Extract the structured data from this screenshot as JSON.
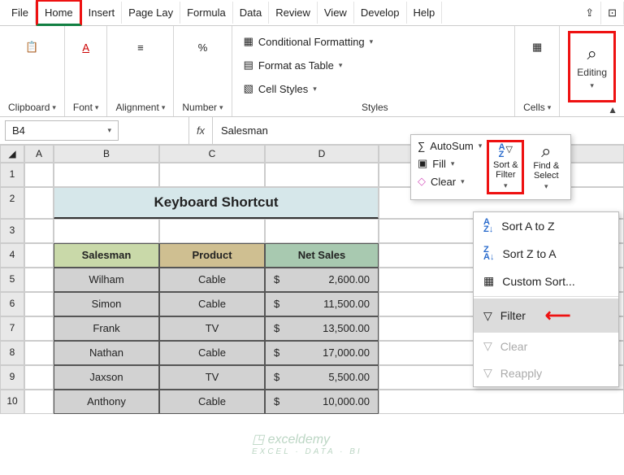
{
  "menu": {
    "tabs": [
      "File",
      "Home",
      "Insert",
      "Page Lay",
      "Formula",
      "Data",
      "Review",
      "View",
      "Develop",
      "Help"
    ],
    "active": 1
  },
  "ribbon": {
    "groups": [
      "Clipboard",
      "Font",
      "Alignment",
      "Number"
    ],
    "styles": {
      "caption": "Styles",
      "items": [
        "Conditional Formatting",
        "Format as Table",
        "Cell Styles"
      ]
    },
    "cells": "Cells",
    "editing": "Editing"
  },
  "editing_panel": {
    "autosum": "AutoSum",
    "fill": "Fill",
    "clear": "Clear",
    "sort_filter": "Sort & Filter",
    "find_select": "Find & Select"
  },
  "submenu": {
    "sort_az": "Sort A to Z",
    "sort_za": "Sort Z to A",
    "custom": "Custom Sort...",
    "filter": "Filter",
    "clear": "Clear",
    "reapply": "Reapply"
  },
  "namebox": "B4",
  "fx": "fx",
  "formula_value": "Salesman",
  "grid": {
    "cols": [
      "",
      "A",
      "B",
      "C",
      "D",
      ""
    ],
    "title": "Keyboard Shortcut",
    "headers": [
      "Salesman",
      "Product",
      "Net Sales"
    ],
    "rows": [
      {
        "n": "4"
      },
      {
        "n": "5",
        "a": "Wilham",
        "b": "Cable",
        "c": "2,600.00"
      },
      {
        "n": "6",
        "a": "Simon",
        "b": "Cable",
        "c": "11,500.00"
      },
      {
        "n": "7",
        "a": "Frank",
        "b": "TV",
        "c": "13,500.00"
      },
      {
        "n": "8",
        "a": "Nathan",
        "b": "Cable",
        "c": "17,000.00"
      },
      {
        "n": "9",
        "a": "Jaxson",
        "b": "TV",
        "c": "5,500.00"
      },
      {
        "n": "10",
        "a": "Anthony",
        "b": "Cable",
        "c": "10,000.00"
      }
    ],
    "currency": "$"
  },
  "watermark": {
    "brand": "exceldemy",
    "sub": "EXCEL · DATA · BI"
  }
}
